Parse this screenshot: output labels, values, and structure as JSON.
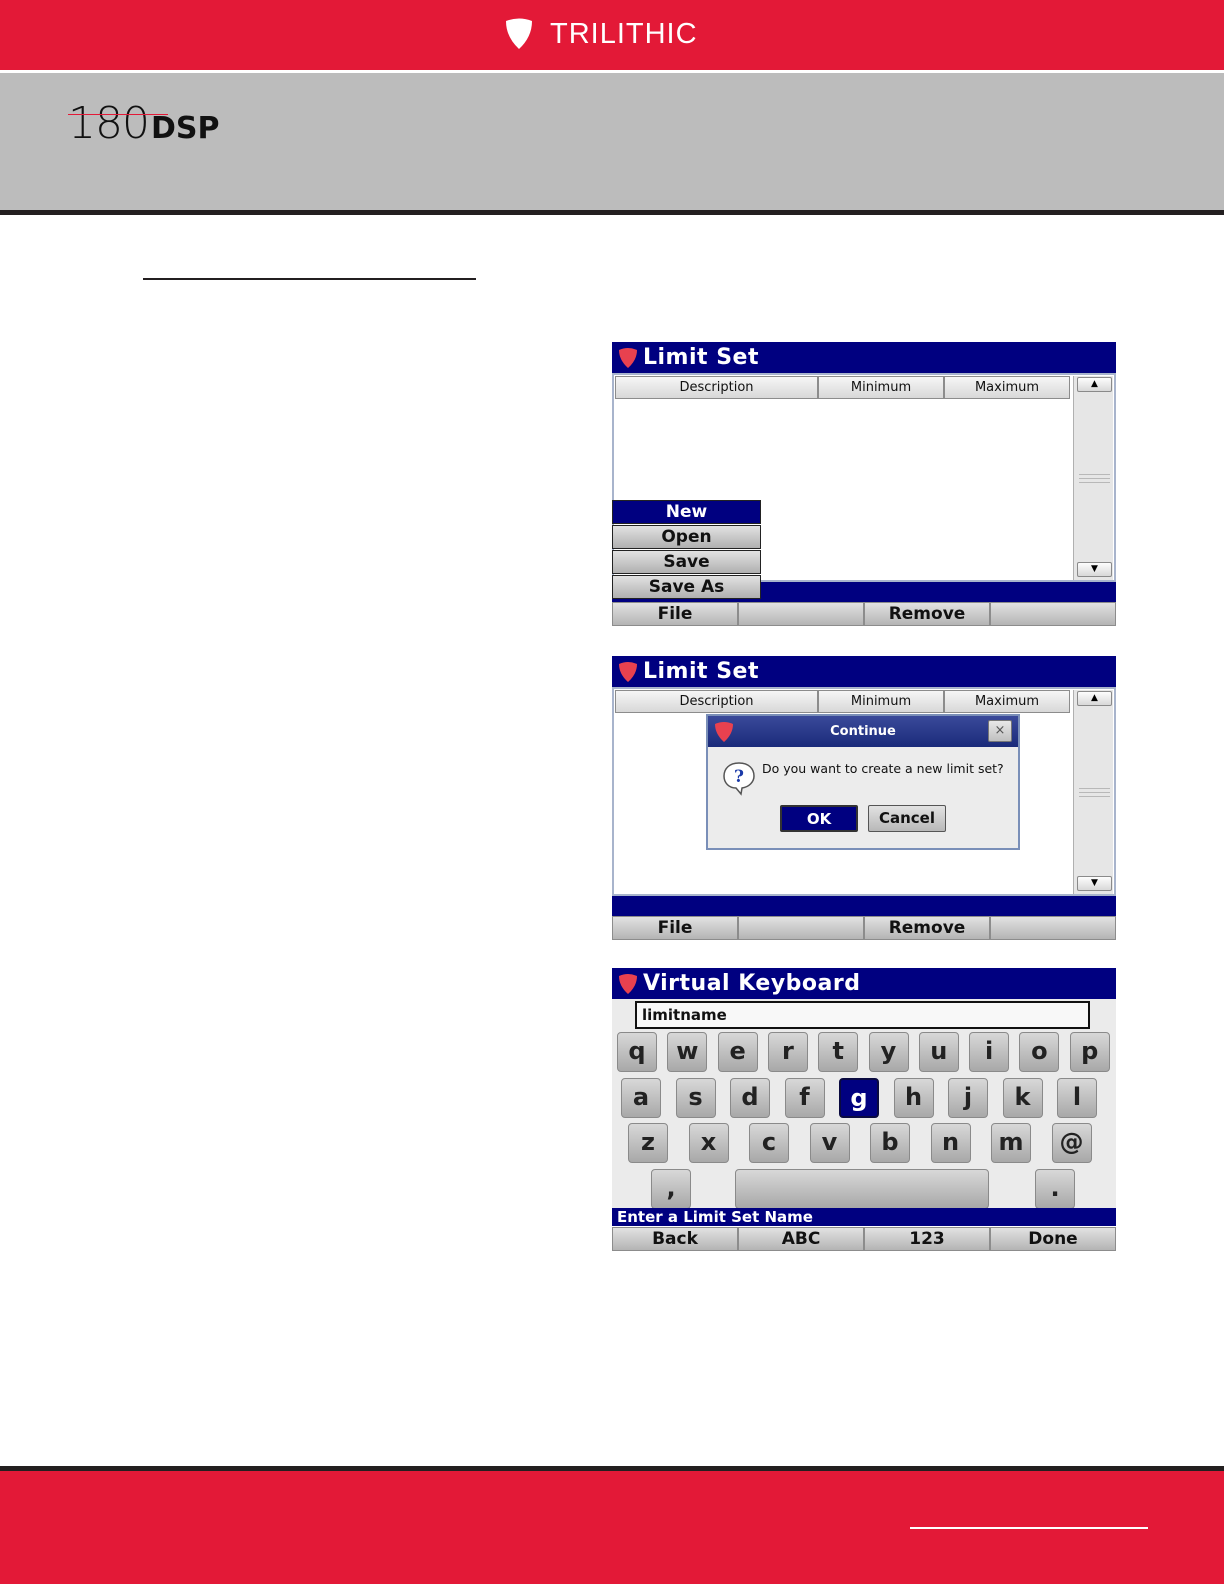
{
  "header": {
    "brand": "TRILITHIC",
    "product_number": "180",
    "product_suffix": "DSP"
  },
  "screen1": {
    "title": "Limit Set",
    "columns": [
      "Description",
      "Minimum",
      "Maximum"
    ],
    "menu": [
      "New",
      "Open",
      "Save",
      "Save As"
    ],
    "menu_selected": "New",
    "softkeys": [
      "File",
      "",
      "Remove",
      ""
    ]
  },
  "screen2": {
    "title": "Limit Set",
    "columns": [
      "Description",
      "Minimum",
      "Maximum"
    ],
    "dialog": {
      "title": "Continue",
      "close": "×",
      "message": "Do you want to create a new limit set?",
      "ok": "OK",
      "cancel": "Cancel"
    },
    "softkeys": [
      "File",
      "",
      "Remove",
      ""
    ]
  },
  "screen3": {
    "title": "Virtual Keyboard",
    "input_value": "limitname",
    "row1": [
      "q",
      "w",
      "e",
      "r",
      "t",
      "y",
      "u",
      "i",
      "o",
      "p"
    ],
    "row2": [
      "a",
      "s",
      "d",
      "f",
      "g",
      "h",
      "j",
      "k",
      "l"
    ],
    "row3": [
      "z",
      "x",
      "c",
      "v",
      "b",
      "n",
      "m",
      "@"
    ],
    "row4": [
      ",",
      "",
      "."
    ],
    "selected_key": "g",
    "status": "Enter a Limit Set Name",
    "softkeys": [
      "Back",
      "ABC",
      "123",
      "Done"
    ]
  },
  "colors": {
    "brand_red": "#e31937",
    "title_blue": "#000080",
    "band_gray": "#bcbcbc"
  }
}
